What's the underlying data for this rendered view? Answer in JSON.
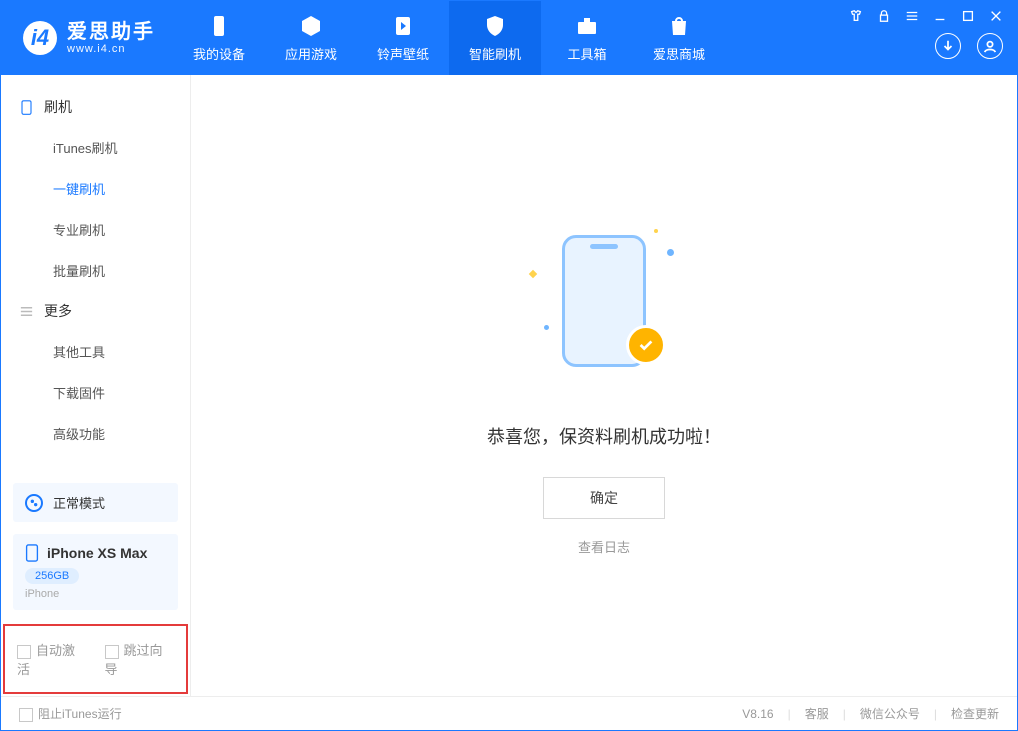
{
  "app": {
    "name": "爱思助手",
    "url": "www.i4.cn"
  },
  "nav": {
    "device": "我的设备",
    "apps": "应用游戏",
    "ring": "铃声壁纸",
    "flash": "智能刷机",
    "tools": "工具箱",
    "store": "爱思商城"
  },
  "sidebar": {
    "group_flash": "刷机",
    "items_flash": {
      "itunes": "iTunes刷机",
      "oneclick": "一键刷机",
      "pro": "专业刷机",
      "batch": "批量刷机"
    },
    "group_more": "更多",
    "items_more": {
      "other": "其他工具",
      "firmware": "下载固件",
      "advanced": "高级功能"
    },
    "mode": "正常模式",
    "device": {
      "name": "iPhone XS Max",
      "capacity": "256GB",
      "type": "iPhone"
    },
    "auto_activate": "自动激活",
    "skip_guide": "跳过向导"
  },
  "main": {
    "message": "恭喜您，保资料刷机成功啦！",
    "ok": "确定",
    "view_log": "查看日志"
  },
  "footer": {
    "block_itunes": "阻止iTunes运行",
    "version": "V8.16",
    "cs": "客服",
    "wechat": "微信公众号",
    "update": "检查更新"
  }
}
